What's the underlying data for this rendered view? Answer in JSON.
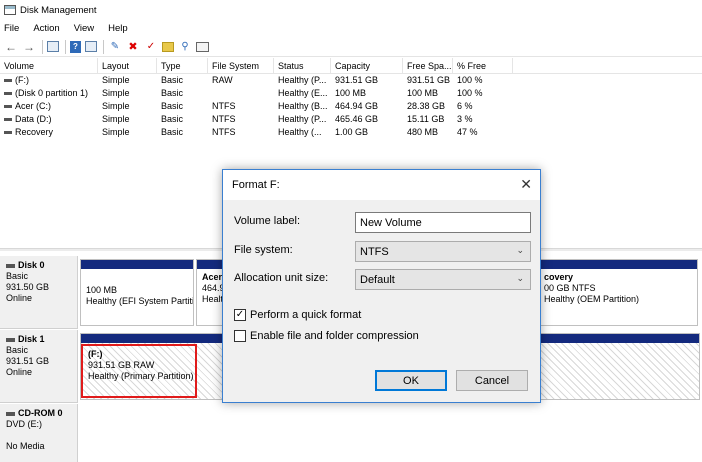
{
  "window": {
    "title": "Disk Management"
  },
  "menu": [
    "File",
    "Action",
    "View",
    "Help"
  ],
  "toolbar": {
    "icons": [
      "back-arrow-icon",
      "forward-arrow-icon",
      "console-tree-icon",
      "help-icon",
      "disk-list-icon",
      "connect-icon",
      "delete-icon",
      "check-icon",
      "new-folder-icon",
      "search-icon",
      "properties-icon"
    ]
  },
  "volume_table": {
    "headers": [
      "Volume",
      "Layout",
      "Type",
      "File System",
      "Status",
      "Capacity",
      "Free Spa...",
      "% Free"
    ],
    "rows": [
      [
        "(F:)",
        "Simple",
        "Basic",
        "RAW",
        "Healthy (P...",
        "931.51 GB",
        "931.51 GB",
        "100 %"
      ],
      [
        "(Disk 0 partition 1)",
        "Simple",
        "Basic",
        "",
        "Healthy (E...",
        "100 MB",
        "100 MB",
        "100 %"
      ],
      [
        "Acer (C:)",
        "Simple",
        "Basic",
        "NTFS",
        "Healthy (B...",
        "464.94 GB",
        "28.38 GB",
        "6 %"
      ],
      [
        "Data (D:)",
        "Simple",
        "Basic",
        "NTFS",
        "Healthy (P...",
        "465.46 GB",
        "15.11 GB",
        "3 %"
      ],
      [
        "Recovery",
        "Simple",
        "Basic",
        "NTFS",
        "Healthy (...",
        "1.00 GB",
        "480 MB",
        "47 %"
      ]
    ]
  },
  "disks": {
    "disk0": {
      "name": "Disk 0",
      "type": "Basic",
      "size": "931.50 GB",
      "status": "Online",
      "p1_size": "100 MB",
      "p1_status": "Healthy (EFI System Partiti",
      "p2_name": "Acer",
      "p2_size": "464.9",
      "p2_status": "Healt",
      "p4_name": "covery",
      "p4_size": "00 GB NTFS",
      "p4_status": "Healthy (OEM Partition)"
    },
    "disk1": {
      "name": "Disk 1",
      "type": "Basic",
      "size": "931.51 GB",
      "status": "Online",
      "p1_name": "(F:)",
      "p1_size": "931.51 GB RAW",
      "p1_status": "Healthy (Primary Partition)"
    },
    "cdrom": {
      "name": "CD-ROM 0",
      "type": "DVD (E:)",
      "status": "No Media"
    }
  },
  "dialog": {
    "title": "Format F:",
    "volume_label_label": "Volume label:",
    "volume_label_value": "New Volume",
    "file_system_label": "File system:",
    "file_system_value": "NTFS",
    "alloc_label": "Allocation unit size:",
    "alloc_value": "Default",
    "quick_format_label": "Perform a quick format",
    "quick_format_checked": true,
    "compression_label": "Enable file and folder compression",
    "compression_checked": false,
    "ok_label": "OK",
    "cancel_label": "Cancel"
  }
}
